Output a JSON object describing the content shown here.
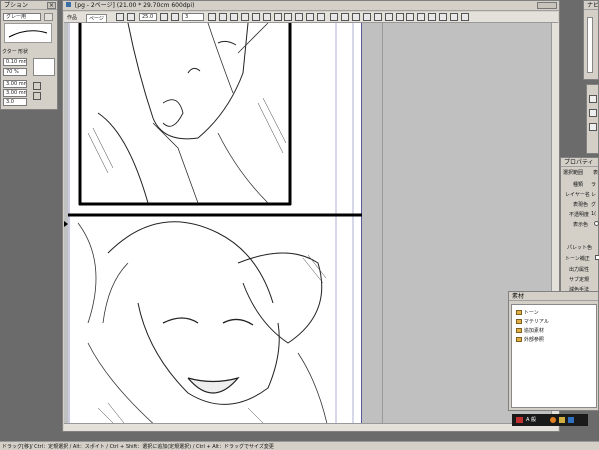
{
  "left_panel": {
    "title": "プション",
    "brush_label": "グレー用",
    "tabs": [
      "クター",
      "形状"
    ],
    "rows": [
      "0.10 mm",
      "70 %",
      "",
      "3.00 mm",
      "3.00 mm",
      "3.0"
    ]
  },
  "document": {
    "title": "[pg - 2ページ] (21.00 * 29.70cm 600dpi)",
    "toolbar": {
      "tab_work": "作品",
      "tab_page": "ページ",
      "zoom": "25.0",
      "page_num": "3"
    }
  },
  "top_right": {
    "label": "ナビゲ"
  },
  "properties_panel": {
    "title": "プロパティ",
    "tabs": [
      "選択範囲",
      "表"
    ],
    "rows": [
      {
        "label": "種類",
        "value": "ラ"
      },
      {
        "label": "レイヤー名",
        "value": "レ"
      },
      {
        "label": "表現色",
        "value": "グ"
      },
      {
        "label": "不透明度",
        "value": "1("
      },
      {
        "label": "表示色",
        "value": ""
      }
    ],
    "rows2": [
      {
        "label": "パレット色",
        "value": ""
      },
      {
        "label": "トーン補正",
        "value": ""
      },
      {
        "label": "出力属性",
        "value": ""
      },
      {
        "label": "サブ定規",
        "value": ""
      },
      {
        "label": "減色手法",
        "value": ""
      }
    ]
  },
  "material_panel": {
    "title": "素材",
    "tree": [
      "トーン",
      "マテリアル",
      "追加素材",
      "外部参照"
    ]
  },
  "taskbar": {
    "text": "A 般"
  },
  "status_bar": {
    "text": "ドラッグ[移]/ Ctrl：定規選択 / Alt：スポイト / Ctrl + Shift：選択に追加(定規選択) / Ctrl + Alt：ドラッグでサイズ変更"
  }
}
